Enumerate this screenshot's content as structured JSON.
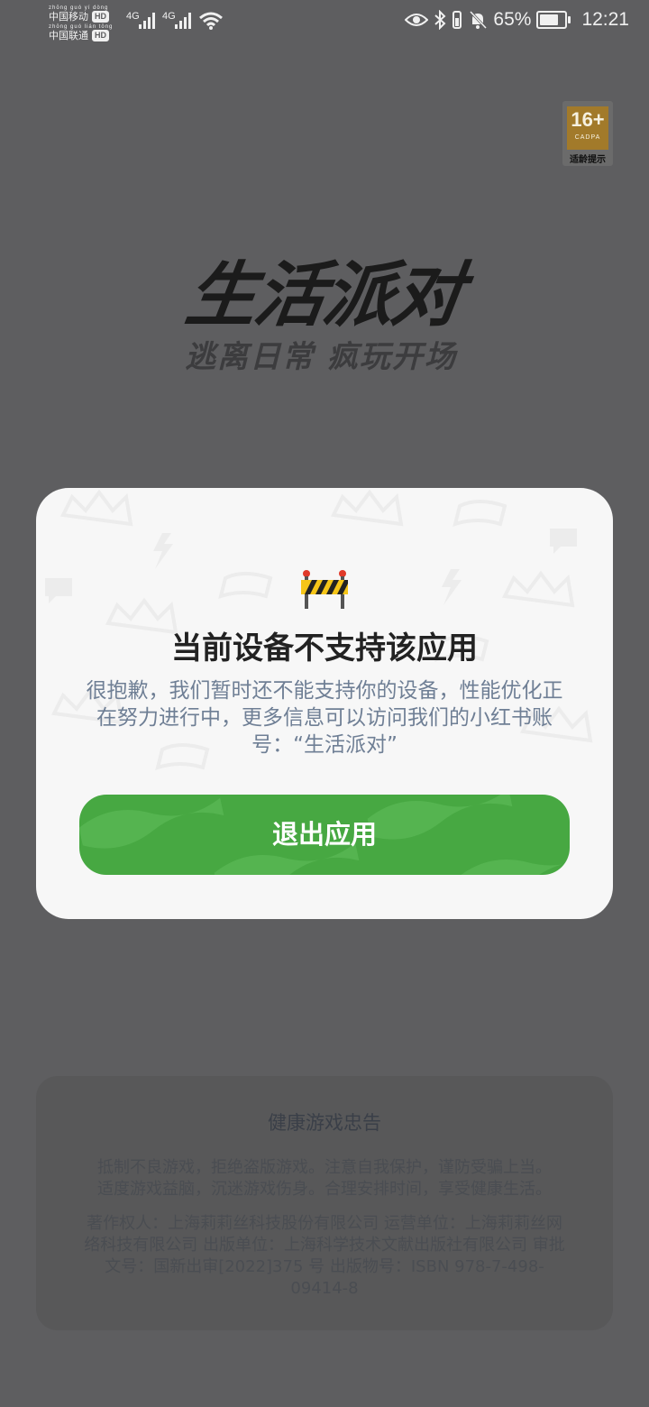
{
  "status_bar": {
    "carrier1_pinyin": "zhōng guó yí dòng",
    "carrier1": "中国移动",
    "carrier2_pinyin": "zhōng guó lián tōng",
    "carrier2": "中国联通",
    "hd": "HD",
    "network1": "4G",
    "network2": "4G",
    "battery_percent": "65%",
    "battery_level": 0.65,
    "time": "12:21",
    "icons": [
      "eye-icon",
      "bluetooth-icon",
      "vibrate-icon",
      "bell-off-icon",
      "wifi-icon",
      "battery-icon"
    ]
  },
  "age_rating": {
    "number": "16+",
    "org": "CADPA",
    "label": "适龄提示"
  },
  "splash": {
    "logo": "生活派对",
    "slogan": "逃离日常 疯玩开场"
  },
  "health_notice": {
    "title": "健康游戏忠告",
    "body_line1": "抵制不良游戏，拒绝盗版游戏。注意自我保护，谨防受骗上当。",
    "body_line2": "适度游戏益脑，沉迷游戏伤身。合理安排时间，享受健康生活。",
    "copyright": "著作权人：上海莉莉丝科技股份有限公司 运营单位：上海莉莉丝网络科技有限公司 出版单位：上海科学技术文献出版社有限公司 审批文号：国新出审[2022]375 号 出版物号：ISBN 978-7-498-09414-8"
  },
  "dialog": {
    "icon": "roadblock-icon",
    "title": "当前设备不支持该应用",
    "message": "很抱歉，我们暂时还不能支持你的设备，性能优化正在努力进行中，更多信息可以访问我们的小红书账号：“生活派对”",
    "button_label": "退出应用",
    "button_color": "#47a842"
  }
}
